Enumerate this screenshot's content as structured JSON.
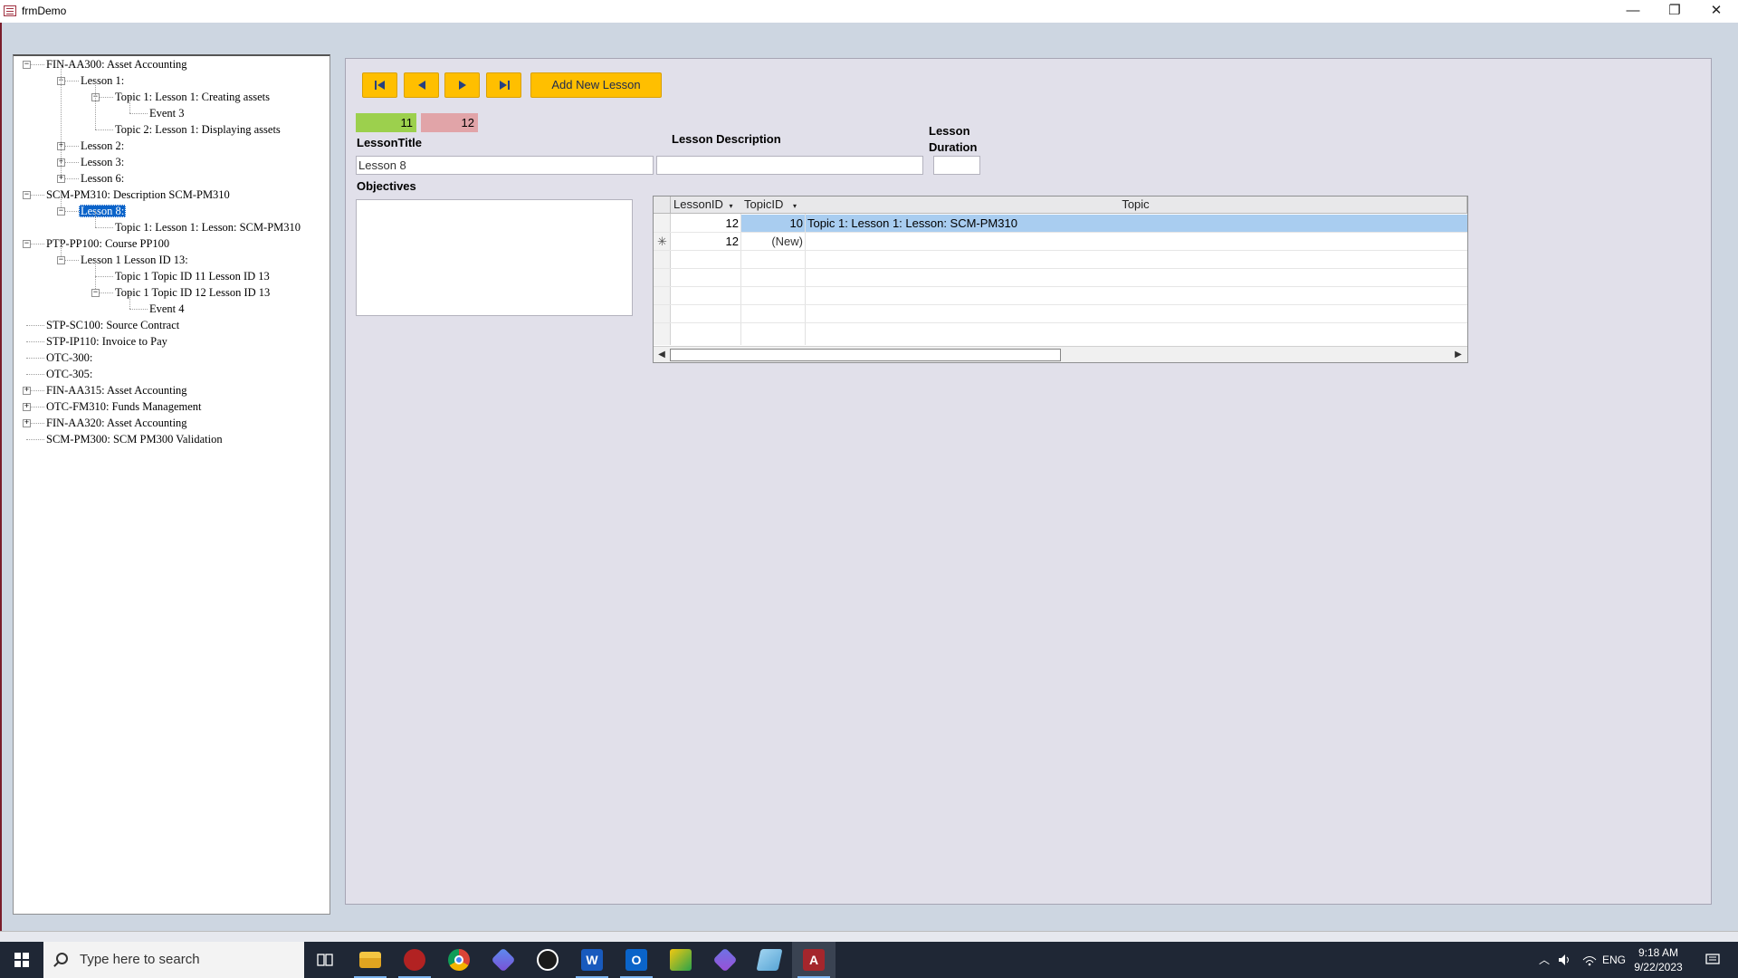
{
  "window": {
    "title": "frmDemo",
    "controls": {
      "minimize": "—",
      "restore": "❐",
      "close": "✕"
    }
  },
  "tree": {
    "rows": [
      {
        "text": "FIN-AA300: Asset Accounting",
        "level": 0,
        "expander": "−"
      },
      {
        "text": "Lesson 1:",
        "level": 1,
        "expander": "−"
      },
      {
        "text": "Topic 1: Lesson 1: Creating assets",
        "level": 2,
        "expander": "−"
      },
      {
        "text": "Event 3",
        "level": 3,
        "expander": ""
      },
      {
        "text": "Topic 2: Lesson 1: Displaying assets",
        "level": 2,
        "expander": ""
      },
      {
        "text": "Lesson 2:",
        "level": 1,
        "expander": "+"
      },
      {
        "text": "Lesson 3:",
        "level": 1,
        "expander": "+"
      },
      {
        "text": "Lesson 6:",
        "level": 1,
        "expander": "+"
      },
      {
        "text": "SCM-PM310: Description SCM-PM310",
        "level": 0,
        "expander": "−"
      },
      {
        "text": "Lesson 8:",
        "level": 1,
        "expander": "−",
        "selected": true
      },
      {
        "text": "Topic 1: Lesson 1: Lesson: SCM-PM310",
        "level": 2,
        "expander": ""
      },
      {
        "text": "PTP-PP100: Course PP100",
        "level": 0,
        "expander": "−"
      },
      {
        "text": "Lesson 1 Lesson ID 13:",
        "level": 1,
        "expander": "−"
      },
      {
        "text": "Topic 1 Topic ID 11 Lesson ID 13",
        "level": 2,
        "expander": ""
      },
      {
        "text": "Topic 1 Topic ID 12 Lesson ID 13",
        "level": 2,
        "expander": "−"
      },
      {
        "text": "Event 4",
        "level": 3,
        "expander": ""
      },
      {
        "text": "STP-SC100: Source Contract",
        "level": 0,
        "expander": ""
      },
      {
        "text": "STP-IP110: Invoice to Pay",
        "level": 0,
        "expander": ""
      },
      {
        "text": "OTC-300:",
        "level": 0,
        "expander": ""
      },
      {
        "text": "OTC-305:",
        "level": 0,
        "expander": ""
      },
      {
        "text": "FIN-AA315: Asset Accounting",
        "level": 0,
        "expander": "+"
      },
      {
        "text": "OTC-FM310: Funds Management",
        "level": 0,
        "expander": "+"
      },
      {
        "text": "FIN-AA320: Asset Accounting",
        "level": 0,
        "expander": "+"
      },
      {
        "text": "SCM-PM300: SCM PM300 Validation",
        "level": 0,
        "expander": ""
      }
    ]
  },
  "toolbar": {
    "first_icon": "first-record-icon",
    "prev_icon": "previous-record-icon",
    "next_icon": "next-record-icon",
    "last_icon": "last-record-icon",
    "add_label": "Add New Lesson",
    "accent": "#ffbf00"
  },
  "counters": {
    "green": "11",
    "red": "12"
  },
  "form": {
    "lesson_title_label": "LessonTitle",
    "lesson_title_value": "Lesson 8",
    "lesson_description_label": "Lesson Description",
    "lesson_description_value": "",
    "lesson_duration_label_1": "Lesson",
    "lesson_duration_label_2": "Duration",
    "lesson_duration_value": "",
    "objectives_label": "Objectives",
    "objectives_value": ""
  },
  "grid": {
    "headers": {
      "lesson_id": "LessonID",
      "topic_id": "TopicID",
      "topic": "Topic"
    },
    "rows": [
      {
        "lesson_id": "12",
        "topic_id": "10",
        "topic": "Topic 1: Lesson 1: Lesson: SCM-PM310"
      },
      {
        "marker": "✳",
        "lesson_id": "12",
        "topic_id": "(New)",
        "topic": ""
      }
    ]
  },
  "taskbar": {
    "search_placeholder": "Type here to search",
    "language": "ENG",
    "time": "9:18 AM",
    "date": "9/22/2023"
  }
}
